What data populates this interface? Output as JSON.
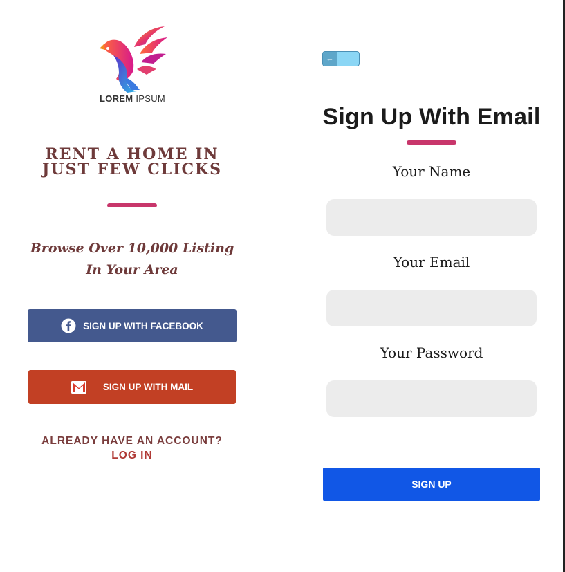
{
  "logo": {
    "brand_bold": "LOREM",
    "brand_light": "IPSUM",
    "icon": "bird-logo-icon"
  },
  "left": {
    "tagline": "RENT A HOME IN JUST FEW CLICKS",
    "browse": "Browse Over 10,000 Listing In Your Area",
    "facebook_button": "SIGN UP WITH FACEBOOK",
    "facebook_icon": "facebook-icon",
    "mail_button": "SIGN UP WITH MAIL",
    "mail_icon": "gmail-icon",
    "already_text": "ALREADY HAVE AN ACCOUNT?",
    "login_link": "LOG IN"
  },
  "right": {
    "back_icon": "back-arrow-icon",
    "title": "Sign Up With Email",
    "name_label": "Your Name",
    "name_value": "",
    "email_label": "Your Email",
    "email_value": "",
    "password_label": "Your Password",
    "password_value": "",
    "signup_button": "SIGN UP"
  },
  "colors": {
    "accent": "#c8366b",
    "facebook": "#44598e",
    "mail": "#c24024",
    "primary": "#1157e6",
    "heading": "#6e3a3a"
  }
}
